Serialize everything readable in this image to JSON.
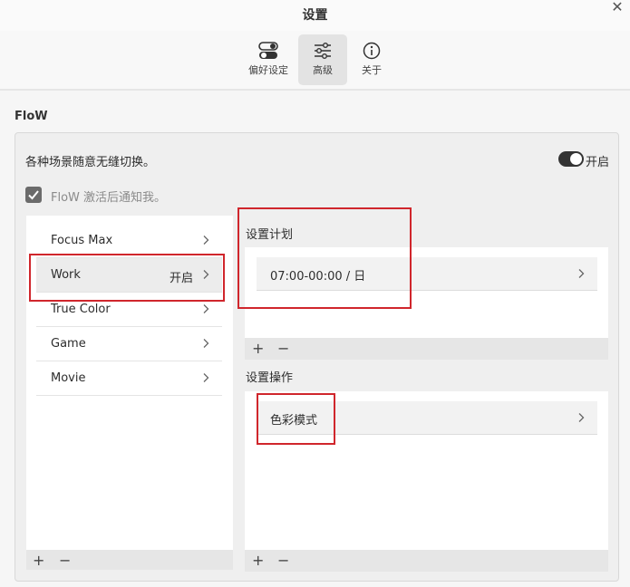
{
  "window": {
    "title": "设置",
    "close_glyph": "✕"
  },
  "tabs": [
    {
      "label": "偏好设定",
      "icon": "toggle-switches-icon",
      "active": false
    },
    {
      "label": "高级",
      "icon": "sliders-icon",
      "active": true
    },
    {
      "label": "关于",
      "icon": "info-icon",
      "active": false
    }
  ],
  "flow": {
    "section_title": "FloW",
    "description": "各种场景随意无缝切换。",
    "toggle_label": "开启",
    "toggle_on": true,
    "notify_label": "FloW 激活后通知我。",
    "notify_checked": true
  },
  "scenes": {
    "items": [
      {
        "name": "Focus Max",
        "status": ""
      },
      {
        "name": "Work",
        "status": "开启"
      },
      {
        "name": "True Color",
        "status": ""
      },
      {
        "name": "Game",
        "status": ""
      },
      {
        "name": "Movie",
        "status": ""
      }
    ],
    "add_label": "+",
    "remove_label": "−"
  },
  "schedule": {
    "title": "设置计划",
    "entries": [
      {
        "text": "07:00-00:00  / 日"
      }
    ],
    "add_label": "+",
    "remove_label": "−"
  },
  "actions": {
    "title": "设置操作",
    "entries": [
      {
        "text": "色彩模式"
      }
    ],
    "add_label": "+",
    "remove_label": "−"
  },
  "colors": {
    "highlight_red": "#d0262c",
    "toggle_dark": "#333333",
    "checkbox_gray": "#6b6b6b"
  }
}
